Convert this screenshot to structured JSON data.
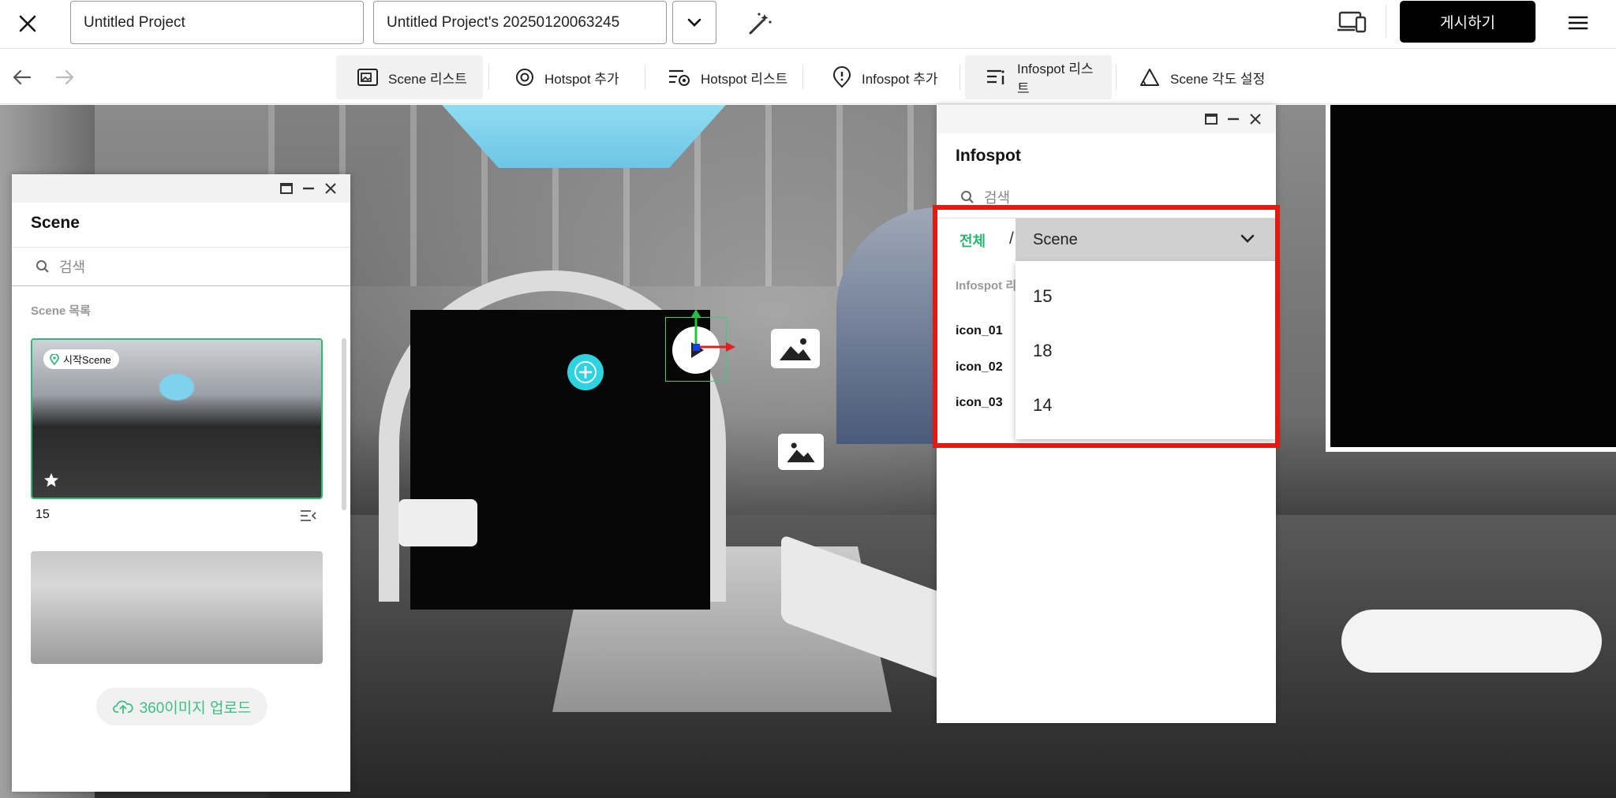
{
  "topbar": {
    "project_name": "Untitled Project",
    "version_name": "Untitled Project's 20250120063245",
    "publish_label": "게시하기"
  },
  "toolbar": {
    "tools": [
      {
        "label": "Scene 리스트",
        "icon": "scene-list-icon",
        "active": true
      },
      {
        "label": "Hotspot 추가",
        "icon": "hotspot-add-icon",
        "active": false
      },
      {
        "label": "Hotspot 리스트",
        "icon": "hotspot-list-icon",
        "active": false
      },
      {
        "label": "Infospot 추가",
        "icon": "infospot-add-icon",
        "active": false
      },
      {
        "label": "Infospot 리스트",
        "icon": "infospot-list-icon",
        "active": true
      },
      {
        "label": "Scene 각도 설정",
        "icon": "scene-angle-icon",
        "active": false
      }
    ]
  },
  "scene_panel": {
    "title": "Scene",
    "search_placeholder": "검색",
    "list_label": "Scene 목록",
    "scenes": [
      {
        "name": "15",
        "badge": "시작Scene",
        "selected": true
      },
      {
        "name": "",
        "badge": "",
        "selected": false
      }
    ],
    "upload_label": "360이미지 업로드"
  },
  "info_panel": {
    "title": "Infospot",
    "search_placeholder": "검색",
    "filter_all": "전체",
    "filter_sep": "/",
    "scene_select_value": "Scene",
    "list_label": "Infospot 리",
    "items": [
      "icon_01",
      "icon_02",
      "icon_03"
    ],
    "dropdown_options": [
      "15",
      "18",
      "14"
    ]
  },
  "colors": {
    "accent_green": "#27b573",
    "highlight_red": "#e21b12",
    "hotspot_cyan": "#2ed3e0",
    "publish_black": "#000000"
  }
}
